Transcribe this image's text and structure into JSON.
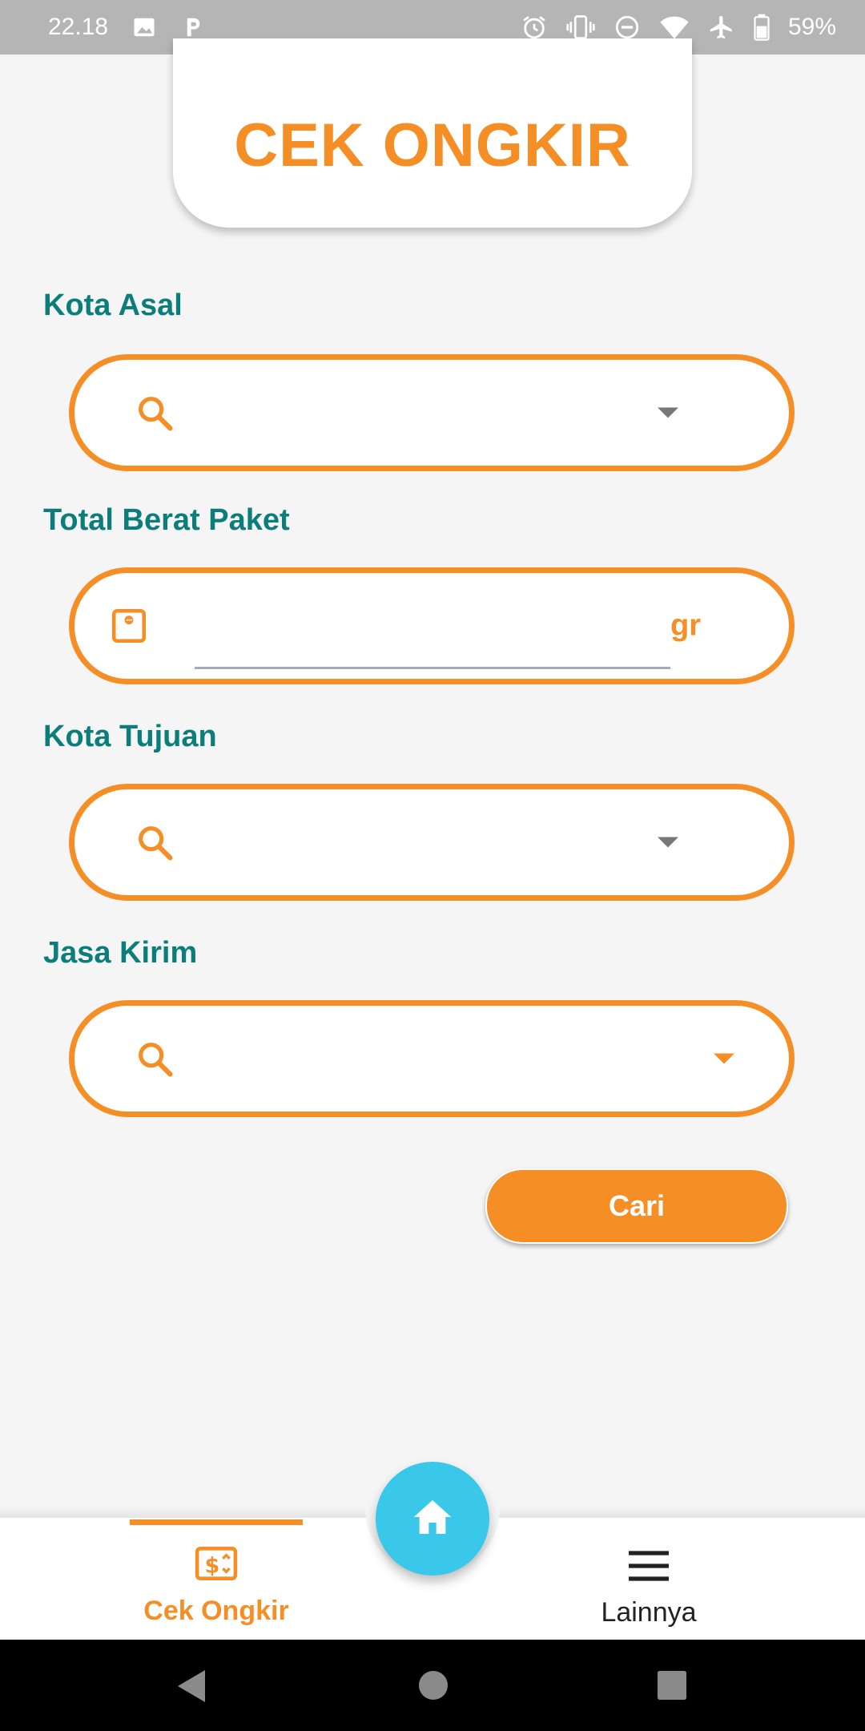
{
  "status_bar": {
    "time": "22.18",
    "battery": "59%",
    "icons": [
      "image-icon",
      "parking-icon",
      "alarm-icon",
      "vibrate-icon",
      "do-not-disturb-icon",
      "wifi-icon",
      "airplane-icon",
      "battery-icon"
    ]
  },
  "header": {
    "title": "CEK ONGKIR"
  },
  "form": {
    "origin": {
      "label": "Kota Asal",
      "icon": "search-icon"
    },
    "weight": {
      "label": "Total Berat Paket",
      "unit": "gr",
      "icon": "scale-icon"
    },
    "destination": {
      "label": "Kota Tujuan",
      "icon": "search-icon"
    },
    "courier": {
      "label": "Jasa Kirim",
      "icon": "search-icon"
    },
    "search_label": "Cari"
  },
  "bottom_nav": {
    "items": [
      {
        "label": "Cek Ongkir",
        "icon": "money-icon",
        "active": true
      },
      {
        "label": "Lainnya",
        "icon": "menu-icon",
        "active": false
      }
    ],
    "fab_icon": "home-icon"
  },
  "colors": {
    "accent": "#f68e26",
    "label": "#0b7d7a",
    "fab": "#3ac8ea",
    "status_bar": "#b5b5b5"
  }
}
